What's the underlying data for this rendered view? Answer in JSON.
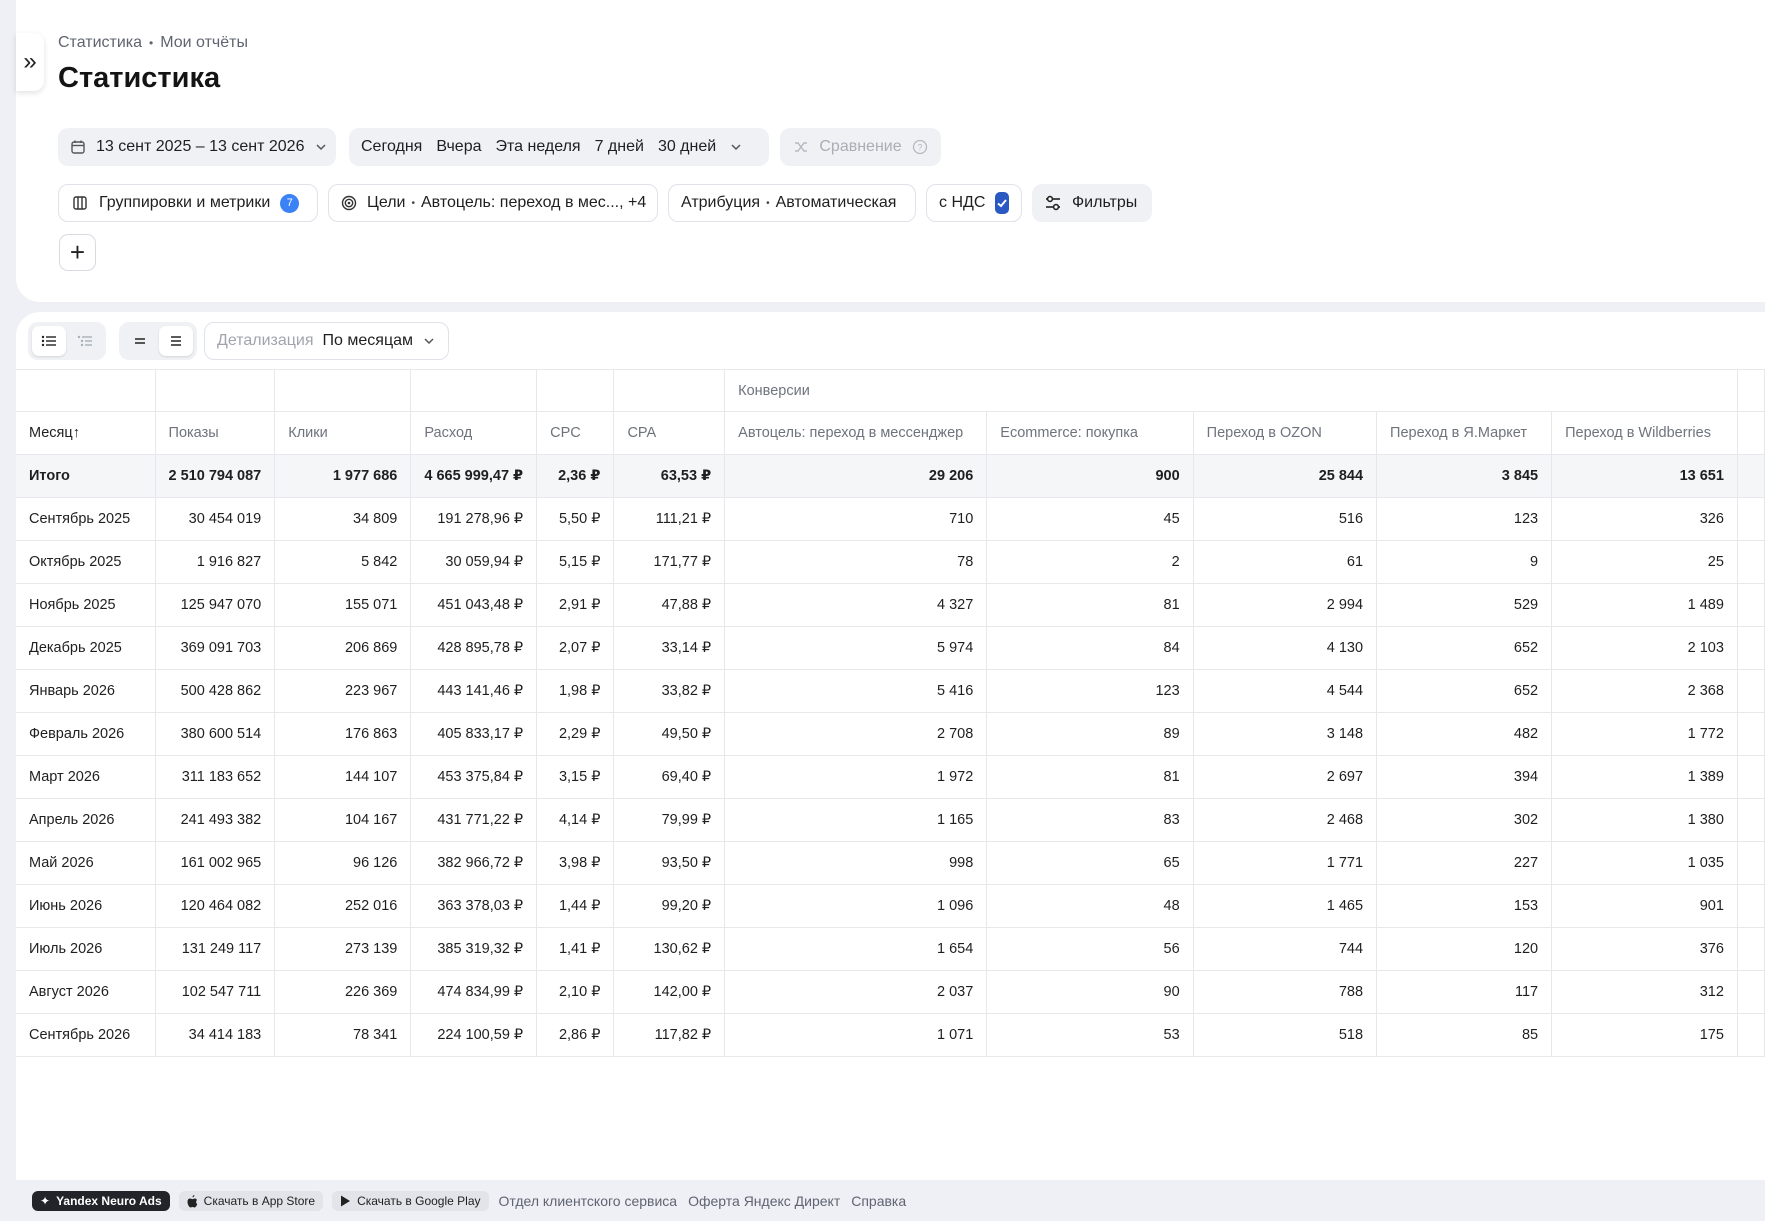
{
  "breadcrumb": [
    "Статистика",
    "Мои отчёты"
  ],
  "page_title": "Статистика",
  "date_range": "13 сент 2025 – 13 сент 2026",
  "quick_ranges": [
    "Сегодня",
    "Вчера",
    "Эта неделя",
    "7 дней",
    "30 дней"
  ],
  "compare": "Сравнение",
  "groupings": {
    "label": "Группировки и метрики",
    "count": "7"
  },
  "goals": {
    "label": "Цели",
    "value": "Автоцель: переход в мес..., +4"
  },
  "attribution": {
    "label": "Атрибуция",
    "value": "Автоматическая"
  },
  "vat": {
    "label": "с НДС",
    "checked": true
  },
  "filters": "Фильтры",
  "detail": {
    "label": "Детализация",
    "value": "По месяцам"
  },
  "table": {
    "group_header": "Конверсии",
    "columns": [
      "Месяц",
      "Показы",
      "Клики",
      "Расход",
      "CPC",
      "CPA",
      "Автоцель: переход в мессенджер",
      "Ecommerce: покупка",
      "Переход в OZON",
      "Переход в Я.Маркет",
      "Переход в Wildberries"
    ],
    "total": [
      "Итого",
      "2 510 794 087",
      "1 977 686",
      "4 665 999,47 ₽",
      "2,36 ₽",
      "63,53 ₽",
      "29 206",
      "900",
      "25 844",
      "3 845",
      "13 651"
    ],
    "rows": [
      [
        "Сентябрь 2025",
        "30 454 019",
        "34 809",
        "191 278,96 ₽",
        "5,50 ₽",
        "111,21 ₽",
        "710",
        "45",
        "516",
        "123",
        "326"
      ],
      [
        "Октябрь 2025",
        "1 916 827",
        "5 842",
        "30 059,94 ₽",
        "5,15 ₽",
        "171,77 ₽",
        "78",
        "2",
        "61",
        "9",
        "25"
      ],
      [
        "Ноябрь 2025",
        "125 947 070",
        "155 071",
        "451 043,48 ₽",
        "2,91 ₽",
        "47,88 ₽",
        "4 327",
        "81",
        "2 994",
        "529",
        "1 489"
      ],
      [
        "Декабрь 2025",
        "369 091 703",
        "206 869",
        "428 895,78 ₽",
        "2,07 ₽",
        "33,14 ₽",
        "5 974",
        "84",
        "4 130",
        "652",
        "2 103"
      ],
      [
        "Январь 2026",
        "500 428 862",
        "223 967",
        "443 141,46 ₽",
        "1,98 ₽",
        "33,82 ₽",
        "5 416",
        "123",
        "4 544",
        "652",
        "2 368"
      ],
      [
        "Февраль 2026",
        "380 600 514",
        "176 863",
        "405 833,17 ₽",
        "2,29 ₽",
        "49,50 ₽",
        "2 708",
        "89",
        "3 148",
        "482",
        "1 772"
      ],
      [
        "Март 2026",
        "311 183 652",
        "144 107",
        "453 375,84 ₽",
        "3,15 ₽",
        "69,40 ₽",
        "1 972",
        "81",
        "2 697",
        "394",
        "1 389"
      ],
      [
        "Апрель 2026",
        "241 493 382",
        "104 167",
        "431 771,22 ₽",
        "4,14 ₽",
        "79,99 ₽",
        "1 165",
        "83",
        "2 468",
        "302",
        "1 380"
      ],
      [
        "Май 2026",
        "161 002 965",
        "96 126",
        "382 966,72 ₽",
        "3,98 ₽",
        "93,50 ₽",
        "998",
        "65",
        "1 771",
        "227",
        "1 035"
      ],
      [
        "Июнь 2026",
        "120 464 082",
        "252 016",
        "363 378,03 ₽",
        "1,44 ₽",
        "99,20 ₽",
        "1 096",
        "48",
        "1 465",
        "153",
        "901"
      ],
      [
        "Июль 2026",
        "131 249 117",
        "273 139",
        "385 319,32 ₽",
        "1,41 ₽",
        "130,62 ₽",
        "1 654",
        "56",
        "744",
        "120",
        "376"
      ],
      [
        "Август 2026",
        "102 547 711",
        "226 369",
        "474 834,99 ₽",
        "2,10 ₽",
        "142,00 ₽",
        "2 037",
        "90",
        "788",
        "117",
        "312"
      ],
      [
        "Сентябрь 2026",
        "34 414 183",
        "78 341",
        "224 100,59 ₽",
        "2,86 ₽",
        "117,82 ₽",
        "1 071",
        "53",
        "518",
        "85",
        "175"
      ]
    ]
  },
  "footer": {
    "brand": "Yandex Neuro Ads",
    "app_store": "Скачать в App Store",
    "google_play": "Скачать в Google Play",
    "links": [
      "Отдел клиентского сервиса",
      "Оферта Яндекс Директ",
      "Справка"
    ]
  }
}
